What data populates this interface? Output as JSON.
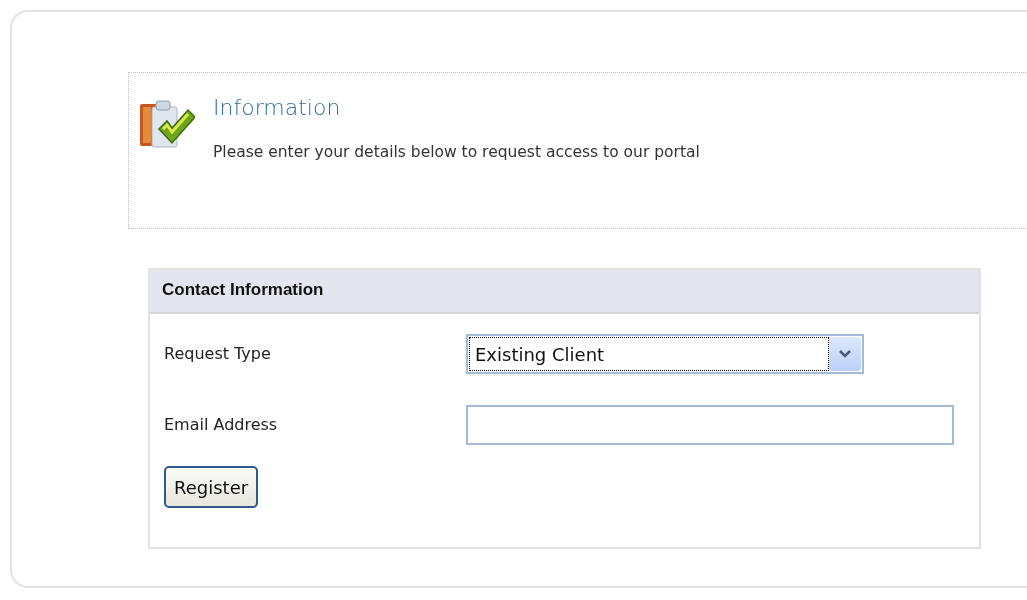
{
  "info": {
    "title": "Information",
    "message": "Please enter your details below to request access to our portal"
  },
  "form": {
    "title": "Contact Information",
    "fields": [
      {
        "kind": "select",
        "label": "Request Type",
        "value": "Existing Client",
        "focused": true
      },
      {
        "kind": "text",
        "label": "Email Address"
      }
    ],
    "button": "Register"
  }
}
